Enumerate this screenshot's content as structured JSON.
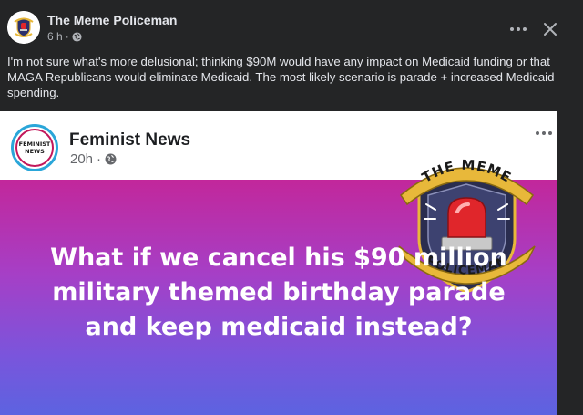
{
  "post": {
    "author": "The Meme Policeman",
    "time": "6 h",
    "separator": "·",
    "text": "I'm not sure what's more delusional; thinking $90M would have any impact on Medicaid funding or that MAGA Republicans would eliminate Medicaid. The most likely scenario is parade + increased Medicaid spending."
  },
  "shared": {
    "page_name": "Feminist News",
    "time": "20h",
    "separator": "·",
    "logo_line1": "FEMINIST",
    "logo_line2": "NEWS",
    "headline_line1": "What if we cancel his $90 million",
    "headline_line2": "military themed birthday parade",
    "headline_line3": "and keep medicaid instead?",
    "watermark_top": "THE MEME",
    "watermark_bottom": "POLICEMAN"
  },
  "icons": {
    "audience": "globe-icon",
    "more": "ellipsis-icon",
    "close": "close-icon"
  },
  "colors": {
    "background": "#242526",
    "text_primary": "#e4e6eb",
    "text_secondary": "#b0b3b8",
    "gradient_top": "#c2279b",
    "gradient_bottom": "#5c63e0",
    "badge_gold": "#e8b83a",
    "siren_red": "#e0262b"
  }
}
